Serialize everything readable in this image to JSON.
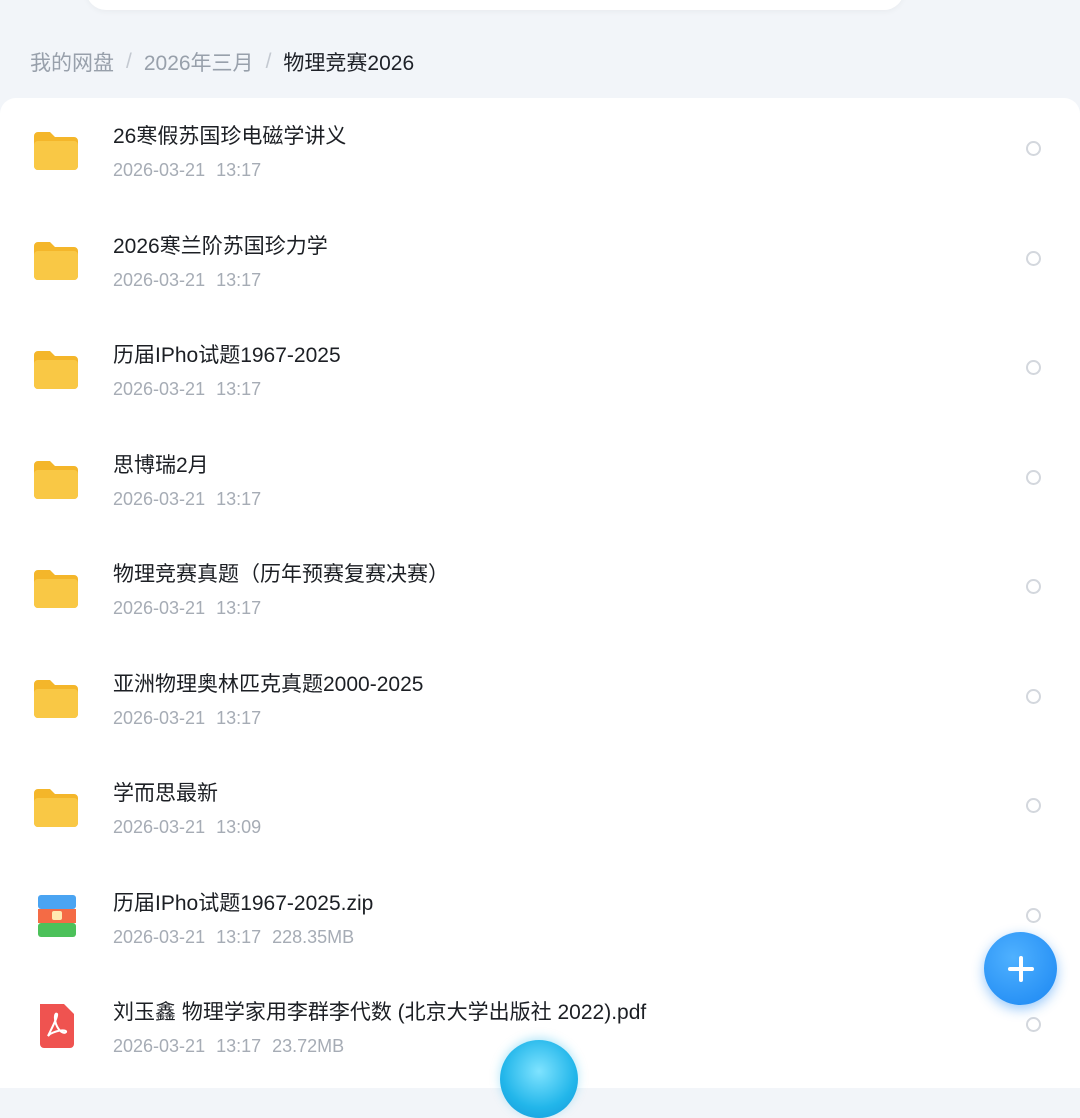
{
  "breadcrumb": {
    "root": "我的网盘",
    "parent": "2026年三月",
    "current": "物理竞赛2026",
    "separator": "/"
  },
  "colors": {
    "folder": "#f9c845",
    "folder_back": "#f4b62a",
    "accent": "#1a86f2",
    "zip_top": "#4aa4f2",
    "zip_mid": "#f46b45",
    "zip_bottom": "#4cc15a",
    "pdf": "#ef5350"
  },
  "fab": {
    "icon": "plus-icon"
  },
  "files": [
    {
      "type": "folder",
      "icon": "folder-icon",
      "name": "26寒假苏国珍电磁学讲义",
      "date": "2026-03-21",
      "time": "13:17",
      "size": ""
    },
    {
      "type": "folder",
      "icon": "folder-icon",
      "name": "2026寒兰阶苏国珍力学",
      "date": "2026-03-21",
      "time": "13:17",
      "size": ""
    },
    {
      "type": "folder",
      "icon": "folder-icon",
      "name": "历届IPho试题1967-2025",
      "date": "2026-03-21",
      "time": "13:17",
      "size": ""
    },
    {
      "type": "folder",
      "icon": "folder-icon",
      "name": "思博瑞2月",
      "date": "2026-03-21",
      "time": "13:17",
      "size": ""
    },
    {
      "type": "folder",
      "icon": "folder-icon",
      "name": "物理竞赛真题（历年预赛复赛决赛）",
      "date": "2026-03-21",
      "time": "13:17",
      "size": ""
    },
    {
      "type": "folder",
      "icon": "folder-icon",
      "name": "亚洲物理奥林匹克真题2000-2025",
      "date": "2026-03-21",
      "time": "13:17",
      "size": ""
    },
    {
      "type": "folder",
      "icon": "folder-icon",
      "name": "学而思最新",
      "date": "2026-03-21",
      "time": "13:09",
      "size": ""
    },
    {
      "type": "zip",
      "icon": "zip-archive-icon",
      "name": "历届IPho试题1967-2025.zip",
      "date": "2026-03-21",
      "time": "13:17",
      "size": "228.35MB"
    },
    {
      "type": "pdf",
      "icon": "pdf-icon",
      "name": "刘玉鑫  物理学家用李群李代数 (北京大学出版社 2022).pdf",
      "date": "2026-03-21",
      "time": "13:17",
      "size": "23.72MB"
    }
  ]
}
